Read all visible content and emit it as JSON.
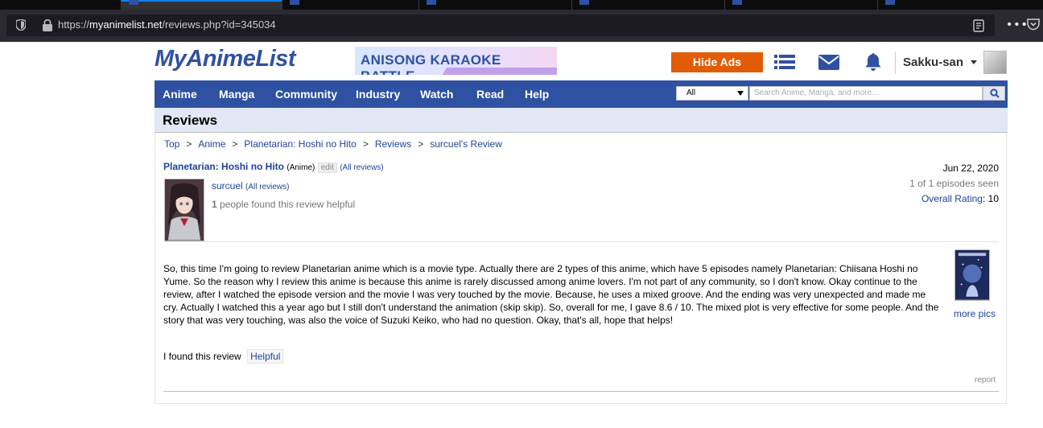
{
  "browser": {
    "url_scheme": "https://",
    "url_domain": "myanimelist.net",
    "url_path": "/reviews.php?id=345034"
  },
  "header": {
    "logo_text": "MyAnimeList",
    "banner_text": "ANISONG KARAOKE BATTLE",
    "hide_ads_label": "Hide Ads",
    "username": "Sakku-san"
  },
  "nav": {
    "items": [
      "Anime",
      "Manga",
      "Community",
      "Industry",
      "Watch",
      "Read",
      "Help"
    ],
    "search_filter": "All",
    "search_placeholder": "Search Anime, Manga, and more..."
  },
  "page": {
    "heading": "Reviews",
    "breadcrumb": [
      "Top",
      "Anime",
      "Planetarian: Hoshi no Hito",
      "Reviews",
      "surcuel's Review"
    ],
    "breadcrumb_sep": ">"
  },
  "review": {
    "anime_title": "Planetarian: Hoshi no Hito",
    "anime_type": "(Anime)",
    "edit_label": "edit",
    "all_reviews_label": "(All reviews)",
    "reviewer": "surcuel",
    "reviewer_all_reviews": "(All reviews)",
    "helpful_count": "1",
    "helpful_suffix": "people found this review helpful",
    "date": "Jun 22, 2020",
    "episodes_seen": "1 of 1 episodes seen",
    "overall_rating_label": "Overall Rating",
    "overall_rating_value": ": 10",
    "body": "So, this time I'm going to review Planetarian anime which is a movie type. Actually there are 2 types of this anime, which have 5 episodes namely Planetarian: Chiisana Hoshi no Yume. So the reason why I review this anime is because this anime is rarely discussed among anime lovers. I'm not part of any community, so I don't know. Okay continue to the review, after I watched the episode version and the movie I was very touched by the movie. Because, he uses a mixed groove. And the ending was very unexpected and made me cry. Actually I watched this a year ago but I still don't understand the animation (skip skip). So, overall for me, I gave 8.6 / 10. The mixed plot is very effective for some people. And the story that was very touching, was also the voice of Suzuki Keiko, who had no question. Okay, that's all, hope that helps!",
    "found_label": "I found this review",
    "helpful_button": "Helpful",
    "more_pics": "more pics",
    "report": "report"
  },
  "colors": {
    "brand_blue": "#2e51a2",
    "link_blue": "#1c439b",
    "hide_ads_orange": "#e25c06",
    "header_band": "#e1e7f5"
  },
  "icons": [
    "shield-icon",
    "lock-icon",
    "reader-view-icon",
    "more-icon",
    "pocket-icon",
    "list-icon",
    "mail-icon",
    "bell-icon",
    "search-icon",
    "chevron-down-icon"
  ]
}
